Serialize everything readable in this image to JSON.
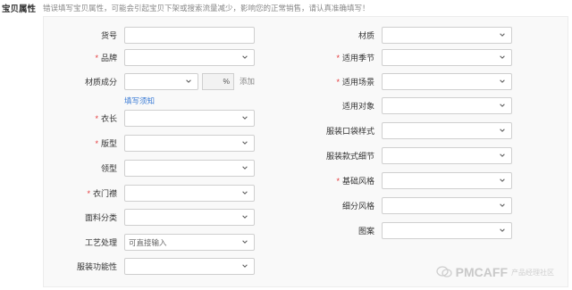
{
  "header": {
    "title": "宝贝属性",
    "hint": "错误填写宝贝属性，可能会引起宝贝下架或搜索流量减少，影响您的正常销售，请认真准确填写！"
  },
  "left": {
    "huohao": {
      "label": "货号",
      "required": false
    },
    "pinpai": {
      "label": "品牌",
      "required": true
    },
    "caizhi_chengfen": {
      "label": "材质成分",
      "required": false,
      "pct": "%",
      "add": "添加",
      "link": "填写须知"
    },
    "yichang": {
      "label": "衣长",
      "required": true
    },
    "banxing": {
      "label": "版型",
      "required": true
    },
    "lingxing": {
      "label": "领型",
      "required": false
    },
    "yimenjin": {
      "label": "衣门襟",
      "required": true
    },
    "mianliao": {
      "label": "面料分类",
      "required": false
    },
    "gongyi": {
      "label": "工艺处理",
      "required": false,
      "placeholder": "可直接输入"
    },
    "gongneng": {
      "label": "服装功能性",
      "required": false
    }
  },
  "right": {
    "caizhi": {
      "label": "材质",
      "required": false
    },
    "jijie": {
      "label": "适用季节",
      "required": true
    },
    "changjing": {
      "label": "适用场景",
      "required": true
    },
    "duixiang": {
      "label": "适用对象",
      "required": false
    },
    "koudai": {
      "label": "服装口袋样式",
      "required": false
    },
    "xijie": {
      "label": "服装款式细节",
      "required": false
    },
    "fengge": {
      "label": "基础风格",
      "required": true
    },
    "xifen": {
      "label": "细分风格",
      "required": false
    },
    "tuan": {
      "label": "图案",
      "required": false
    }
  },
  "watermark": {
    "brand": "PMCAFF",
    "sub": "产品经理社区"
  },
  "required_mark": "*"
}
